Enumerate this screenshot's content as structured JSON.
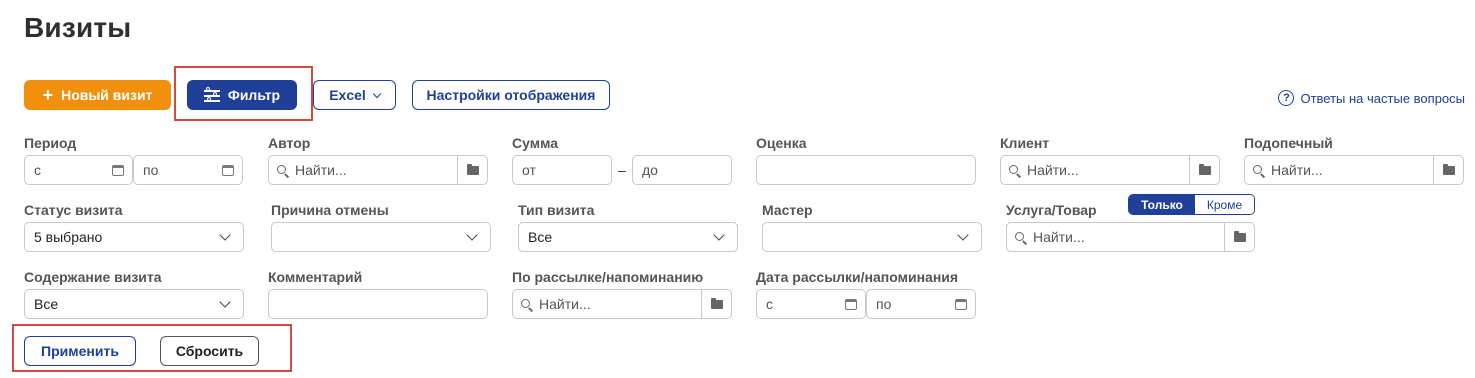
{
  "page": {
    "title": "Визиты"
  },
  "toolbar": {
    "new_visit": "Новый визит",
    "filter": "Фильтр",
    "excel": "Excel",
    "display_settings": "Настройки отображения",
    "faq": "Ответы на частые вопросы"
  },
  "filters": {
    "period": {
      "label": "Период",
      "from_placeholder": "с",
      "to_placeholder": "по"
    },
    "author": {
      "label": "Автор",
      "placeholder": "Найти..."
    },
    "sum": {
      "label": "Сумма",
      "from_placeholder": "от",
      "to_placeholder": "до",
      "separator": "–"
    },
    "rating": {
      "label": "Оценка",
      "value": ""
    },
    "client": {
      "label": "Клиент",
      "placeholder": "Найти..."
    },
    "ward": {
      "label": "Подопечный",
      "placeholder": "Найти..."
    },
    "visit_status": {
      "label": "Статус визита",
      "value": "5 выбрано"
    },
    "cancel_reason": {
      "label": "Причина отмены",
      "value": ""
    },
    "visit_type": {
      "label": "Тип визита",
      "value": "Все"
    },
    "master": {
      "label": "Мастер",
      "value": ""
    },
    "service": {
      "label": "Услуга/Товар",
      "placeholder": "Найти...",
      "mode_only": "Только",
      "mode_except": "Кроме"
    },
    "visit_content": {
      "label": "Содержание визита",
      "value": "Все"
    },
    "comment": {
      "label": "Комментарий",
      "value": ""
    },
    "mailing": {
      "label": "По рассылке/напоминанию",
      "placeholder": "Найти..."
    },
    "mailing_date": {
      "label": "Дата рассылки/напоминания",
      "from_placeholder": "с",
      "to_placeholder": "по"
    }
  },
  "actions": {
    "apply": "Применить",
    "reset": "Сбросить"
  },
  "colors": {
    "accent_orange": "#f0900c",
    "primary_blue": "#1f3f99",
    "highlight_red": "#d44a3f"
  }
}
